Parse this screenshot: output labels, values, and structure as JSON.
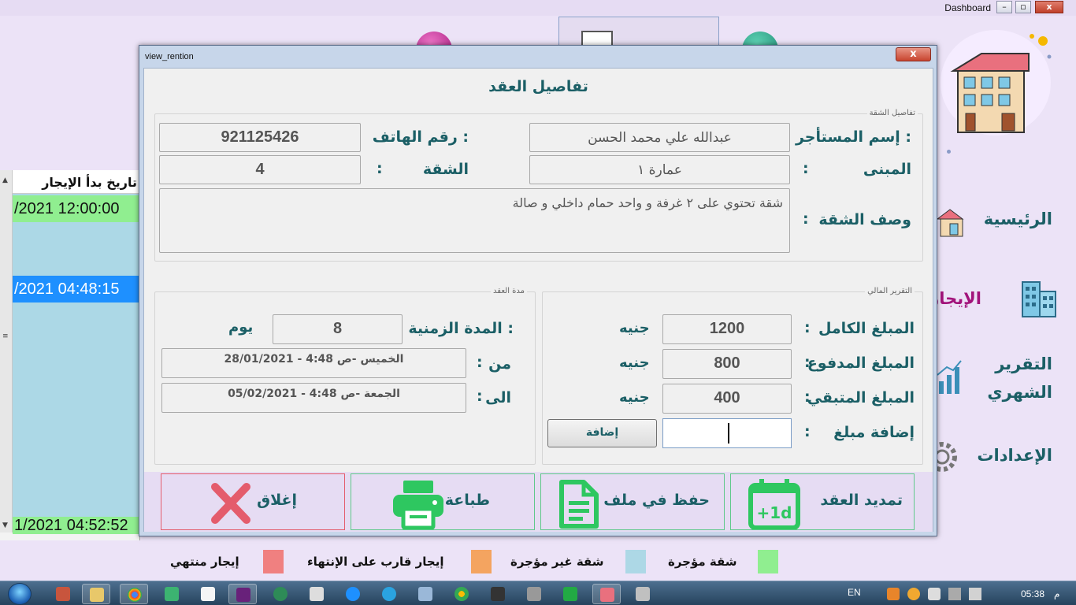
{
  "window": {
    "title": "Dashboard"
  },
  "background_grid": {
    "header": "تاريخ بدأ الإيجار",
    "rows": [
      "/2021 12:00:00",
      "/2021 04:48:15",
      "1/2021 04:52:52"
    ]
  },
  "side_menu": {
    "items": [
      "الرئيسية",
      "الإيجار",
      "التقرير",
      "الشهري",
      "الإعدادات"
    ]
  },
  "legend": [
    {
      "label": "شقة مؤجرة",
      "color": "#90ee90"
    },
    {
      "label": "شقة غير مؤجرة",
      "color": "#add8e6"
    },
    {
      "label": "إيجار قارب على الإنتهاء",
      "color": "#f4a460"
    },
    {
      "label": "إيجار منتهي",
      "color": "#f08080"
    }
  ],
  "taskbar": {
    "lang": "EN",
    "time": "05:38",
    "ampm": "م"
  },
  "dialog": {
    "title": "view_rention",
    "close_glyph": "x",
    "heading": "تفاصيل العقد",
    "apartment_group": {
      "caption": "تفاصيل الشقة",
      "tenant_label": "إسم المستأجر :",
      "tenant_value": "عبدالله علي محمد الحسن",
      "phone_label": "رقم الهاتف :",
      "phone_value": "921125426",
      "building_label": "المبنى",
      "building_value": "عمارة ١",
      "apartment_label": "الشقة",
      "apartment_value": "4",
      "description_label": "وصف الشقة",
      "description_value": "شقة تحتوي على ٢ غرفة و واحد حمام داخلي و صالة",
      "colon": ":"
    },
    "financial_group": {
      "caption": "التقرير المالي",
      "full_label": "المبلغ الكامل",
      "full_value": "1200",
      "paid_label": "المبلغ المدفوع",
      "paid_value": "800",
      "remaining_label": "المبلغ المتبقي",
      "remaining_value": "400",
      "add_label": "إضافة مبلغ",
      "add_input_value": "",
      "add_button": "إضافة",
      "currency": "جنيه",
      "colon": ":"
    },
    "duration_group": {
      "caption": "مدة العقد",
      "duration_label": "المدة الزمنية :",
      "duration_value": "8",
      "duration_unit": "يوم",
      "from_label": "من",
      "from_value": "الخميس -ص 4:48 -  28/01/2021",
      "to_label": "الى",
      "to_value": "الجمعة -ص 4:48 -  05/02/2021",
      "colon": ":"
    },
    "actions": {
      "extend": "تمديد العقد",
      "save": "حفظ في ملف",
      "print": "طباعة",
      "close": "إغلاق",
      "extend_icon_text": "+1d"
    }
  }
}
